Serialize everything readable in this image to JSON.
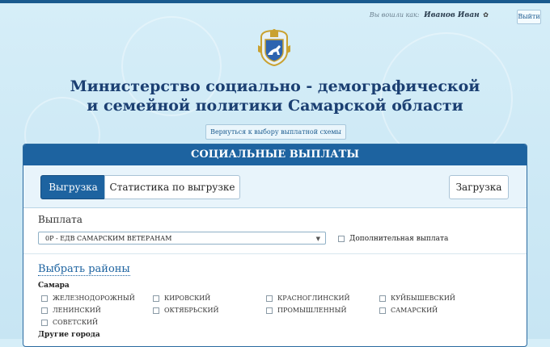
{
  "user_bar": {
    "label": "Вы вошли как:",
    "user_name": "Иванов Иван",
    "gear_icon": "gear-icon",
    "logout_label": "Выйти"
  },
  "header": {
    "emblem_icon": "samara-region-coat-of-arms",
    "title_line1": "Министерство социально - демографической",
    "title_line2": "и семейной политики Самарской области",
    "back_label": "Вернуться к выбору выплатной схемы"
  },
  "panel": {
    "heading": "СОЦИАЛЬНЫЕ ВЫПЛАТЫ",
    "tabs": [
      {
        "label": "Выгрузка",
        "active": true
      },
      {
        "label": "Статистика по выгрузке",
        "active": false
      },
      {
        "label": "Загрузка",
        "active": false
      }
    ],
    "payout_label": "Выплата",
    "payout_selected": "0Р - ЕДВ САМАРСКИМ ВЕТЕРАНАМ",
    "additional_payout_label": "Дополнительная выплата",
    "choose_districts_label": "Выбрать районы",
    "group_samara": "Самара",
    "group_other": "Другие города",
    "districts": [
      "ЖЕЛЕЗНОДОРОЖНЫЙ",
      "КИРОВСКИЙ",
      "КРАСНОГЛИНСКИЙ",
      "КУЙБЫШЕВСКИЙ",
      "ЛЕНИНСКИЙ",
      "ОКТЯБРЬСКИЙ",
      "ПРОМЫШЛЕННЫЙ",
      "САМАРСКИЙ",
      "СОВЕТСКИЙ"
    ]
  },
  "colors": {
    "accent": "#1d63a0",
    "title": "#1b3f72",
    "background": "#d6eef8"
  }
}
